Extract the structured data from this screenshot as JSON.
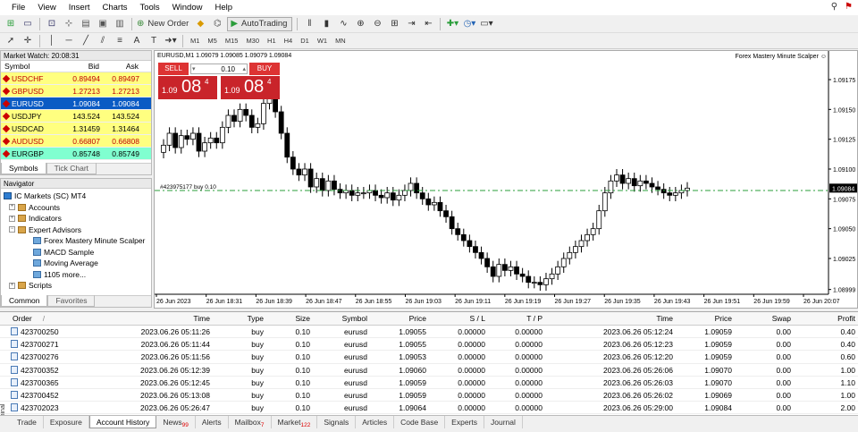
{
  "menu": {
    "items": [
      "File",
      "View",
      "Insert",
      "Charts",
      "Tools",
      "Window",
      "Help"
    ]
  },
  "toolbar": {
    "new_order": "New Order",
    "autotrading": "AutoTrading",
    "timeframes": [
      "M1",
      "M5",
      "M15",
      "M30",
      "H1",
      "H4",
      "D1",
      "W1",
      "MN"
    ]
  },
  "market_watch": {
    "title": "Market Watch: 20:08:31",
    "columns": [
      "Symbol",
      "Bid",
      "Ask"
    ],
    "rows": [
      {
        "symbol": "USDCHF",
        "bid": "0.89494",
        "ask": "0.89497",
        "bg": "#ffff80",
        "fg": "#c00000"
      },
      {
        "symbol": "GBPUSD",
        "bid": "1.27213",
        "ask": "1.27213",
        "bg": "#ffff80",
        "fg": "#c00000"
      },
      {
        "symbol": "EURUSD",
        "bid": "1.09084",
        "ask": "1.09084",
        "bg": "#0a5bc4",
        "fg": "#ffffff"
      },
      {
        "symbol": "USDJPY",
        "bid": "143.524",
        "ask": "143.524",
        "bg": "#ffff80",
        "fg": "#000000"
      },
      {
        "symbol": "USDCAD",
        "bid": "1.31459",
        "ask": "1.31464",
        "bg": "#ffff80",
        "fg": "#000000"
      },
      {
        "symbol": "AUDUSD",
        "bid": "0.66807",
        "ask": "0.66808",
        "bg": "#ffff80",
        "fg": "#c00000"
      },
      {
        "symbol": "EURGBP",
        "bid": "0.85748",
        "ask": "0.85749",
        "bg": "#80ffd0",
        "fg": "#000000"
      }
    ],
    "tabs": [
      "Symbols",
      "Tick Chart"
    ]
  },
  "navigator": {
    "title": "Navigator",
    "items": [
      {
        "label": "IC Markets (SC) MT4"
      },
      {
        "label": "Accounts"
      },
      {
        "label": "Indicators"
      },
      {
        "label": "Expert Advisors"
      },
      {
        "label": "Forex Mastery Minute Scalper"
      },
      {
        "label": "MACD Sample"
      },
      {
        "label": "Moving Average"
      },
      {
        "label": "1105 more..."
      },
      {
        "label": "Scripts"
      }
    ],
    "tabs": [
      "Common",
      "Favorites"
    ]
  },
  "chart": {
    "header": "EURUSD,M1  1.09079 1.09085 1.09079 1.09084",
    "ea_name": "Forex Mastery Minute Scalper ☺",
    "sell_label": "SELL",
    "buy_label": "BUY",
    "lot": "0.10",
    "sell_price": {
      "small": "1.09",
      "big": "08",
      "sup": "4"
    },
    "buy_price": {
      "small": "1.09",
      "big": "08",
      "sup": "4"
    },
    "order_line_label": "#423975177 buy 0.10",
    "current_price_label": "1.09084"
  },
  "chart_data": {
    "type": "candlestick",
    "symbol": "EURUSD",
    "timeframe": "M1",
    "y_ticks": [
      "1.09175",
      "1.09150",
      "1.09125",
      "1.09100",
      "1.09075",
      "1.09050",
      "1.09025",
      "1.08999"
    ],
    "x_ticks": [
      "26 Jun 2023",
      "26 Jun 18:31",
      "26 Jun 18:39",
      "26 Jun 18:47",
      "26 Jun 18:55",
      "26 Jun 19:03",
      "26 Jun 19:11",
      "26 Jun 19:19",
      "26 Jun 19:27",
      "26 Jun 19:35",
      "26 Jun 19:43",
      "26 Jun 19:51",
      "26 Jun 19:59",
      "26 Jun 20:07"
    ],
    "ylim": [
      1.08995,
      1.0919
    ],
    "close_series": [
      1.0912,
      1.0913,
      1.09118,
      1.09128,
      1.09125,
      1.0913,
      1.09115,
      1.09122,
      1.09126,
      1.09122,
      1.09135,
      1.09145,
      1.0914,
      1.0915,
      1.09145,
      1.09135,
      1.09138,
      1.09155,
      1.09165,
      1.09148,
      1.0913,
      1.0911,
      1.091,
      1.09095,
      1.091,
      1.09085,
      1.09092,
      1.09082,
      1.0909,
      1.09083,
      1.0908,
      1.09082,
      1.09078,
      1.0908,
      1.0908,
      1.09082,
      1.09078,
      1.09076,
      1.0908,
      1.09074,
      1.09078,
      1.09082,
      1.09088,
      1.0908,
      1.09075,
      1.0907,
      1.09072,
      1.09065,
      1.0906,
      1.0905,
      1.09045,
      1.0904,
      1.09035,
      1.0903,
      1.09025,
      1.09018,
      1.0901,
      1.0902,
      1.09015,
      1.09018,
      1.09012,
      1.0901,
      1.09005,
      1.09005,
      1.09003,
      1.09008,
      1.09012,
      1.09018,
      1.09025,
      1.0903,
      1.09035,
      1.0904,
      1.09045,
      1.0905,
      1.09065,
      1.0908,
      1.0909,
      1.09095,
      1.09088,
      1.09092,
      1.09086,
      1.0909,
      1.09088,
      1.09085,
      1.09083,
      1.0908,
      1.09078,
      1.0908,
      1.09082,
      1.09084
    ],
    "order_line": 1.09082
  },
  "orders": {
    "columns": [
      "Order",
      "Time",
      "Type",
      "Size",
      "Symbol",
      "Price",
      "S / L",
      "T / P",
      "Time",
      "Price",
      "Swap",
      "Profit"
    ],
    "rows": [
      [
        "423700250",
        "2023.06.26 05:11:26",
        "buy",
        "0.10",
        "eurusd",
        "1.09055",
        "0.00000",
        "0.00000",
        "2023.06.26 05:12:24",
        "1.09059",
        "0.00",
        "0.40"
      ],
      [
        "423700271",
        "2023.06.26 05:11:44",
        "buy",
        "0.10",
        "eurusd",
        "1.09055",
        "0.00000",
        "0.00000",
        "2023.06.26 05:12:23",
        "1.09059",
        "0.00",
        "0.40"
      ],
      [
        "423700276",
        "2023.06.26 05:11:56",
        "buy",
        "0.10",
        "eurusd",
        "1.09053",
        "0.00000",
        "0.00000",
        "2023.06.26 05:12:20",
        "1.09059",
        "0.00",
        "0.60"
      ],
      [
        "423700352",
        "2023.06.26 05:12:39",
        "buy",
        "0.10",
        "eurusd",
        "1.09060",
        "0.00000",
        "0.00000",
        "2023.06.26 05:26:06",
        "1.09070",
        "0.00",
        "1.00"
      ],
      [
        "423700365",
        "2023.06.26 05:12:45",
        "buy",
        "0.10",
        "eurusd",
        "1.09059",
        "0.00000",
        "0.00000",
        "2023.06.26 05:26:03",
        "1.09070",
        "0.00",
        "1.10"
      ],
      [
        "423700452",
        "2023.06.26 05:13:08",
        "buy",
        "0.10",
        "eurusd",
        "1.09059",
        "0.00000",
        "0.00000",
        "2023.06.26 05:26:02",
        "1.09069",
        "0.00",
        "1.00"
      ],
      [
        "423702023",
        "2023.06.26 05:26:47",
        "buy",
        "0.10",
        "eurusd",
        "1.09064",
        "0.00000",
        "0.00000",
        "2023.06.26 05:29:00",
        "1.09084",
        "0.00",
        "2.00"
      ]
    ]
  },
  "bottom_tabs": [
    {
      "label": "Trade",
      "badge": ""
    },
    {
      "label": "Exposure",
      "badge": ""
    },
    {
      "label": "Account History",
      "badge": ""
    },
    {
      "label": "News",
      "badge": "99"
    },
    {
      "label": "Alerts",
      "badge": ""
    },
    {
      "label": "Mailbox",
      "badge": "7"
    },
    {
      "label": "Market",
      "badge": "122"
    },
    {
      "label": "Signals",
      "badge": ""
    },
    {
      "label": "Articles",
      "badge": ""
    },
    {
      "label": "Code Base",
      "badge": ""
    },
    {
      "label": "Experts",
      "badge": ""
    },
    {
      "label": "Journal",
      "badge": ""
    }
  ],
  "terminal_label": "Terminal"
}
